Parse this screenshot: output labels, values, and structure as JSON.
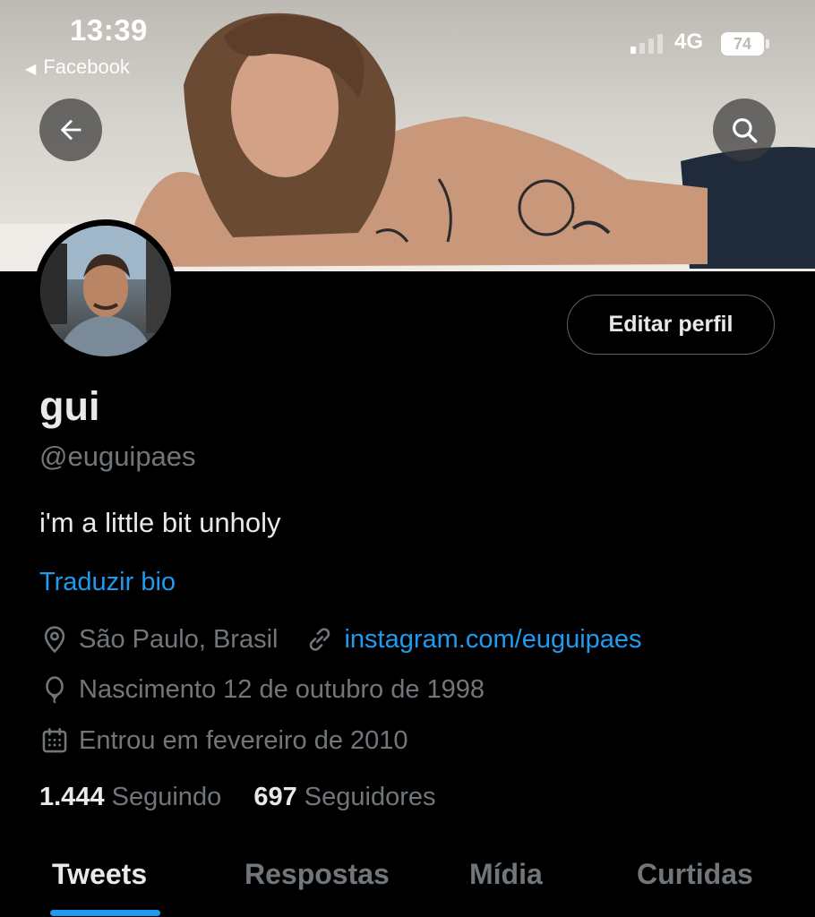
{
  "status_bar": {
    "time": "13:39",
    "back_app": "Facebook",
    "network": "4G",
    "battery": "74"
  },
  "header": {
    "back_icon": "arrow-left-icon",
    "search_icon": "search-icon"
  },
  "profile": {
    "edit_label": "Editar perfil",
    "name": "gui",
    "handle": "@euguipaes",
    "bio": "i'm a little bit unholy",
    "translate_label": "Traduzir bio",
    "location": "São Paulo, Brasil",
    "website": "instagram.com/euguipaes",
    "birthday": "Nascimento 12 de outubro de 1998",
    "joined": "Entrou em fevereiro de 2010",
    "following_count": "1.444",
    "following_label": "Seguindo",
    "followers_count": "697",
    "followers_label": "Seguidores"
  },
  "tabs": [
    {
      "label": "Tweets",
      "active": true
    },
    {
      "label": "Respostas",
      "active": false
    },
    {
      "label": "Mídia",
      "active": false
    },
    {
      "label": "Curtidas",
      "active": false
    }
  ],
  "colors": {
    "accent": "#1d9bf0",
    "background": "#000000",
    "secondary_text": "#71767b"
  }
}
